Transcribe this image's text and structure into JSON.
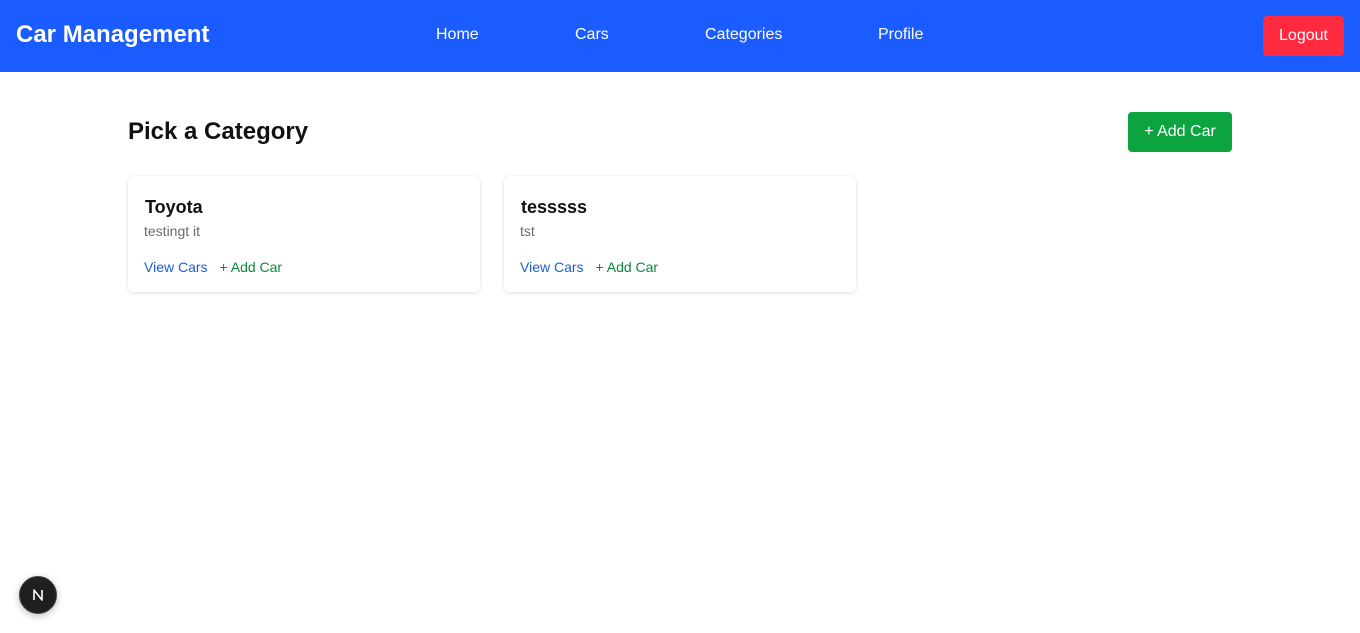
{
  "navbar": {
    "brand": "Car Management",
    "links": [
      {
        "label": "Home"
      },
      {
        "label": "Cars"
      },
      {
        "label": "Categories"
      },
      {
        "label": "Profile"
      }
    ],
    "logout_label": "Logout",
    "background_color": "#1a5cff",
    "logout_color": "#ff2a40"
  },
  "main": {
    "title": "Pick a Category",
    "add_car_label": "+ Add Car",
    "add_car_color": "#0ba43f",
    "categories": [
      {
        "name": "Toyota",
        "description": "testingt it",
        "view_label": "View Cars",
        "add_label": "+ Add Car"
      },
      {
        "name": "tesssss",
        "description": "tst",
        "view_label": "View Cars",
        "add_label": "+ Add Car"
      }
    ]
  },
  "dev_badge": {
    "icon": "nextjs-logo-icon"
  }
}
